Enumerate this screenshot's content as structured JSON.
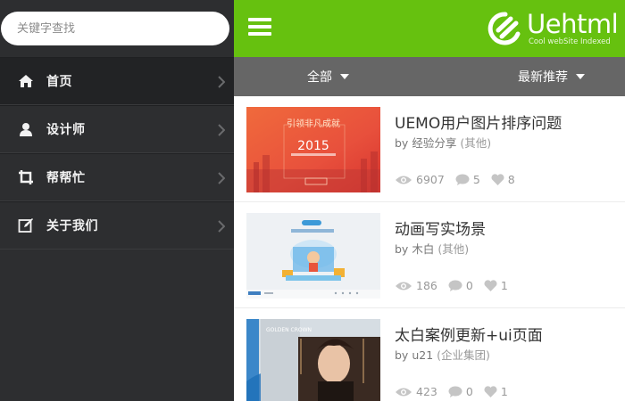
{
  "sidebar": {
    "search_placeholder": "关键字查找",
    "items": [
      {
        "label": "首页",
        "icon": "home-icon",
        "active": true
      },
      {
        "label": "设计师",
        "icon": "user-icon",
        "active": false
      },
      {
        "label": "帮帮忙",
        "icon": "crop-icon",
        "active": false
      },
      {
        "label": "关于我们",
        "icon": "edit-icon",
        "active": false
      }
    ]
  },
  "header": {
    "logo_text": "Uehtml",
    "logo_subtext": "Cool webSite Indexed",
    "accent": "#66c10f"
  },
  "filters": {
    "all_label": "全部",
    "sort_label": "最新推荐"
  },
  "posts": [
    {
      "title": "UEMO用户图片排序问题",
      "by": "by",
      "author": "经验分享",
      "category": "(其他)",
      "views": "6907",
      "comments": "5",
      "likes": "8",
      "thumb_text_1": "引领非凡成就",
      "thumb_text_2": "2015"
    },
    {
      "title": "动画写实场景",
      "by": "by",
      "author": "木白",
      "category": "(其他)",
      "views": "186",
      "comments": "0",
      "likes": "1"
    },
    {
      "title": "太白案例更新+ui页面",
      "by": "by",
      "author": "u21",
      "category": "(企业集团)",
      "views": "423",
      "comments": "0",
      "likes": "1",
      "thumb_text_1": "GOLDEN CROWN"
    }
  ]
}
